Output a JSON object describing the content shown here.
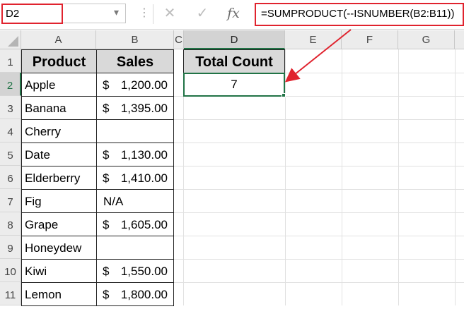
{
  "name_box": {
    "value": "D2"
  },
  "formula_bar": {
    "formula": "=SUMPRODUCT(--ISNUMBER(B2:B11))",
    "cancel_glyph": "✕",
    "enter_glyph": "✓",
    "fx_label": "fx",
    "dots": "⋮"
  },
  "columns": [
    "A",
    "B",
    "C",
    "D",
    "E",
    "F",
    "G"
  ],
  "rows": [
    "1",
    "2",
    "3",
    "4",
    "5",
    "6",
    "7",
    "8",
    "9",
    "10",
    "11"
  ],
  "table": {
    "headers": {
      "product": "Product",
      "sales": "Sales"
    },
    "data": [
      {
        "product": "Apple",
        "currency": "$",
        "sales": "1,200.00"
      },
      {
        "product": "Banana",
        "currency": "$",
        "sales": "1,395.00"
      },
      {
        "product": "Cherry",
        "currency": "",
        "sales": ""
      },
      {
        "product": "Date",
        "currency": "$",
        "sales": "1,130.00"
      },
      {
        "product": "Elderberry",
        "currency": "$",
        "sales": "1,410.00"
      },
      {
        "product": "Fig",
        "currency": "",
        "sales": "N/A"
      },
      {
        "product": "Grape",
        "currency": "$",
        "sales": "1,605.00"
      },
      {
        "product": "Honeydew",
        "currency": "",
        "sales": ""
      },
      {
        "product": "Kiwi",
        "currency": "$",
        "sales": "1,550.00"
      },
      {
        "product": "Lemon",
        "currency": "$",
        "sales": "1,800.00"
      }
    ]
  },
  "result": {
    "header": "Total Count",
    "value": "7"
  },
  "colors": {
    "highlight_red": "#e0232e",
    "excel_green": "#217346",
    "header_gray": "#d9d9d9"
  }
}
